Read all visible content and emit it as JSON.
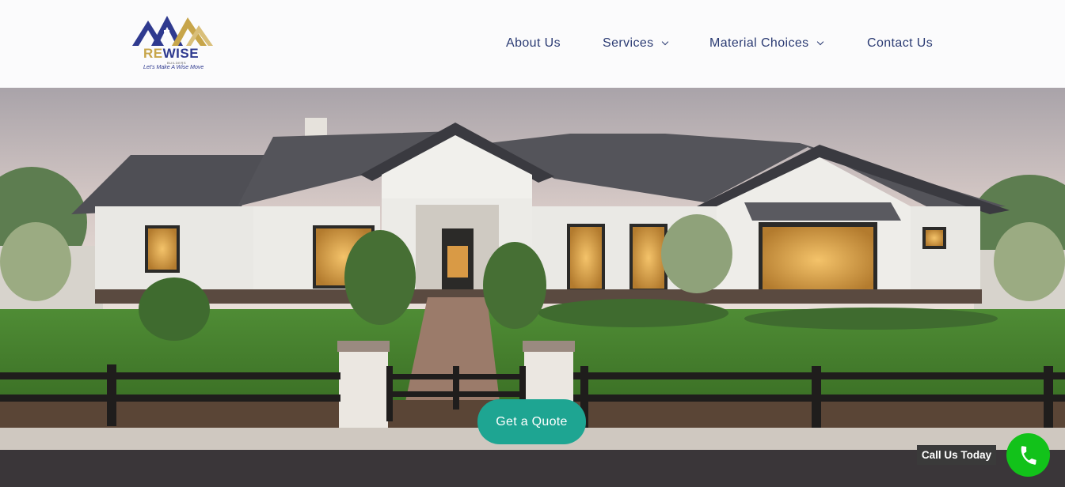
{
  "brand": {
    "name_part1": "RE",
    "name_part2": "WISE",
    "subtitle": "BUILDERS",
    "tagline": "Let's Make A Wise Move",
    "colors": {
      "navy": "#2f3a8f",
      "gold": "#c7a54a"
    }
  },
  "nav": {
    "items": [
      {
        "label": "About Us",
        "has_dropdown": false
      },
      {
        "label": "Services",
        "has_dropdown": true
      },
      {
        "label": "Material Choices",
        "has_dropdown": true
      },
      {
        "label": "Contact Us",
        "has_dropdown": false
      }
    ],
    "color": "#2b3b73"
  },
  "hero": {
    "image": "modern-farmhouse-exterior-photo",
    "cta_label": "Get a Quote",
    "cta_color": "#1ea592"
  },
  "call_widget": {
    "label": "Call Us Today",
    "icon": "phone-icon",
    "color": "#12c21a"
  }
}
